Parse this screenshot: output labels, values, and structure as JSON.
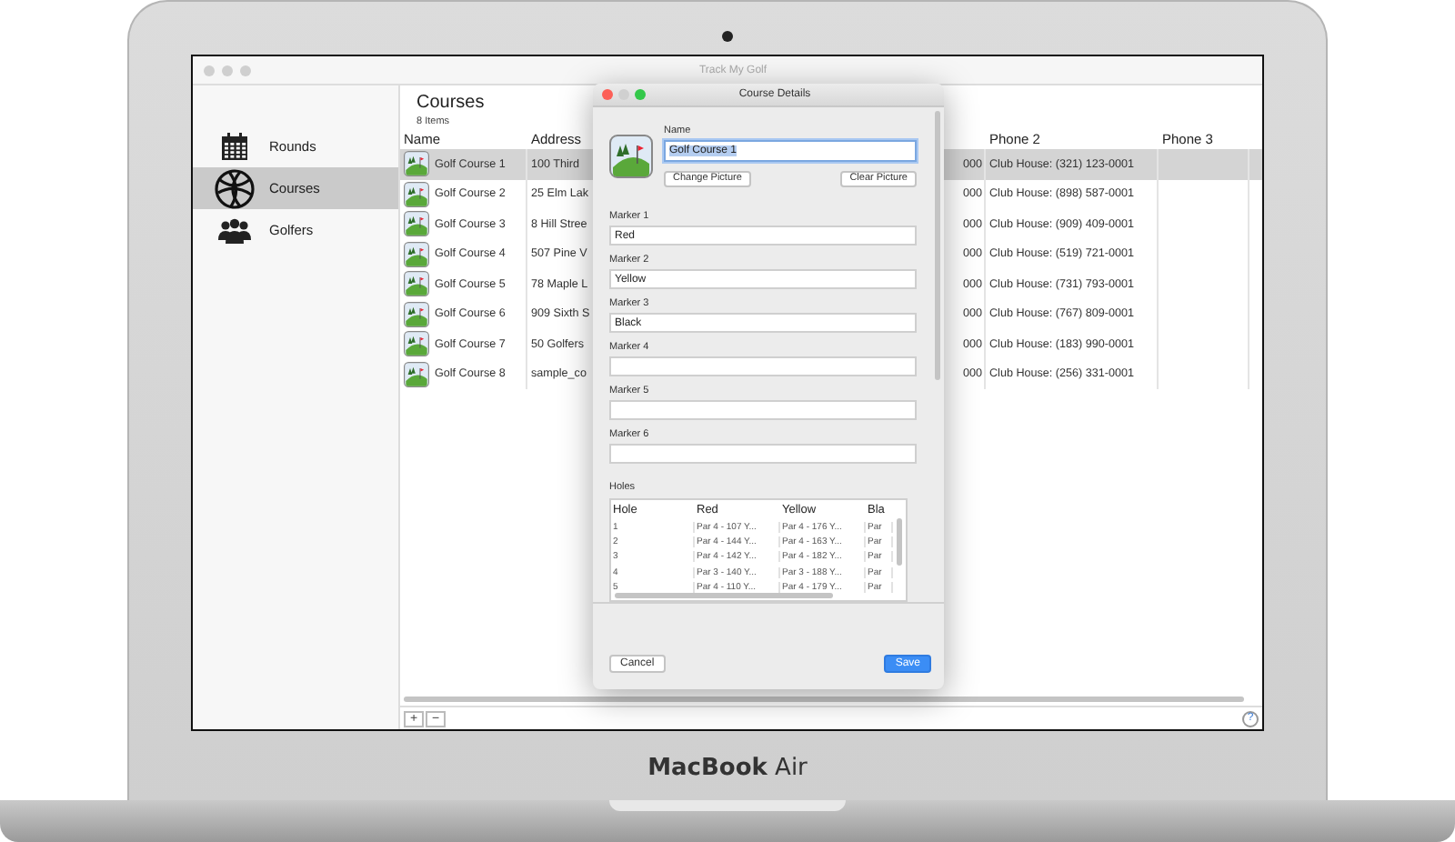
{
  "laptop": {
    "label": "**MacBook** Air"
  },
  "window": {
    "title": "Track My Golf"
  },
  "sidebar": {
    "items": [
      {
        "kind": "calendar",
        "label": "Rounds",
        "selected": false
      },
      {
        "kind": "globe",
        "label": "Courses",
        "selected": true
      },
      {
        "kind": "people",
        "label": "Golfers",
        "selected": false
      }
    ]
  },
  "header": {
    "title": "Courses",
    "count": "8 Items"
  },
  "table": {
    "columns": [
      {
        "kind": "name",
        "heading": "Name"
      },
      {
        "kind": "text",
        "heading": "Address"
      },
      {
        "kind": "hidden"
      },
      {
        "kind": "text",
        "heading": "Phone 2"
      },
      {
        "kind": "text",
        "heading": "Phone 3"
      }
    ],
    "rows": [
      {
        "selected": true,
        "cells": [
          "Golf Course 1",
          "100 Third",
          "000",
          "Club House: (321) 123-0001"
        ]
      },
      {
        "selected": false,
        "cells": [
          "Golf Course 2",
          "25 Elm Lak",
          "000",
          "Club House: (898) 587-0001"
        ]
      },
      {
        "selected": false,
        "cells": [
          "Golf Course 3",
          "8 Hill Stree",
          "000",
          "Club House: (909) 409-0001"
        ]
      },
      {
        "selected": false,
        "cells": [
          "Golf Course 4",
          "507 Pine V",
          "000",
          "Club House: (519) 721-0001"
        ]
      },
      {
        "selected": false,
        "cells": [
          "Golf Course 5",
          "78 Maple L",
          "000",
          "Club House: (731) 793-0001"
        ]
      },
      {
        "selected": false,
        "cells": [
          "Golf Course 6",
          "909 Sixth S",
          "000",
          "Club House: (767) 809-0001"
        ]
      },
      {
        "selected": false,
        "cells": [
          "Golf Course 7",
          "50 Golfers",
          "000",
          "Club House: (183) 990-0001"
        ]
      },
      {
        "selected": false,
        "cells": [
          "Golf Course 8",
          "sample_co",
          "000",
          "Club House: (256) 331-0001"
        ]
      }
    ]
  },
  "footer": {
    "add": "+",
    "remove": "−",
    "help": "?"
  },
  "dialog": {
    "title": "Course Details",
    "name_label": "Name",
    "name_value": "Golf Course 1",
    "name_highlighted": true,
    "picture_buttons": [
      "Change Picture",
      "Clear Picture"
    ],
    "markers": [
      {
        "label": "Marker 1",
        "value": "Red"
      },
      {
        "label": "Marker 2",
        "value": "Yellow"
      },
      {
        "label": "Marker 3",
        "value": "Black"
      },
      {
        "label": "Marker 4"
      },
      {
        "label": "Marker 5"
      },
      {
        "label": "Marker 6"
      }
    ],
    "holes_label": "Holes",
    "holes": {
      "columns": [
        "Hole",
        "Red",
        "Yellow",
        "Bla"
      ],
      "rows": [
        [
          "1",
          "Par 4 - 107 Y...",
          "Par 4 - 176 Y...",
          "Par"
        ],
        [
          "2",
          "Par 4 - 144 Y...",
          "Par 4 - 163 Y...",
          "Par"
        ],
        [
          "3",
          "Par 4 - 142 Y...",
          "Par 4 - 182 Y...",
          "Par"
        ],
        [
          "4",
          "Par 3 - 140 Y...",
          "Par 3 - 188 Y...",
          "Par"
        ],
        [
          "5",
          "Par 4 - 110 Y...",
          "Par 4 - 179 Y...",
          "Par"
        ]
      ]
    },
    "buttons": [
      {
        "kind": "normal",
        "label": "Cancel"
      },
      {
        "kind": "default",
        "label": "Save"
      }
    ]
  }
}
